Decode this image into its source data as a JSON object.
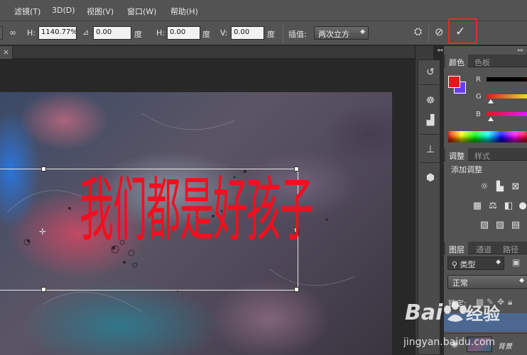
{
  "menubar": {
    "items": [
      {
        "label": "滤镜(T)"
      },
      {
        "label": "3D(D)"
      },
      {
        "label": "视图(V)"
      },
      {
        "label": "窗口(W)"
      },
      {
        "label": "帮助(H)"
      }
    ]
  },
  "options": {
    "h_label": "H:",
    "h_value": "1140.77%",
    "angle_value": "0.00",
    "angle_unit": "度",
    "hskew_label": "H:",
    "hskew_value": "0.00",
    "hskew_unit": "度",
    "vskew_label": "V:",
    "vskew_value": "0.00",
    "vskew_unit": "度",
    "interp_label": "插值:",
    "interp_value": "两次立方"
  },
  "document": {
    "text": "我们都是好孩子"
  },
  "color_panel": {
    "tabs": [
      "颜色",
      "色板"
    ],
    "r_label": "R",
    "g_label": "G",
    "b_label": "B",
    "foreground": "#e8141e",
    "background": "#6a3cff"
  },
  "adjust_panel": {
    "tabs": [
      "调整",
      "样式"
    ],
    "heading": "添加调整"
  },
  "layers_panel": {
    "tabs": [
      "图层",
      "通道",
      "路径"
    ],
    "filter_label": "类型",
    "blend_mode": "正常",
    "lock_label": "锁定:",
    "layer_name": "背景"
  },
  "watermark": {
    "brand": "Baidu经验",
    "url": "jingyan.baidu.com"
  },
  "colors": {
    "highlight": "#e52a2a",
    "text_red": "#f20f1f"
  }
}
